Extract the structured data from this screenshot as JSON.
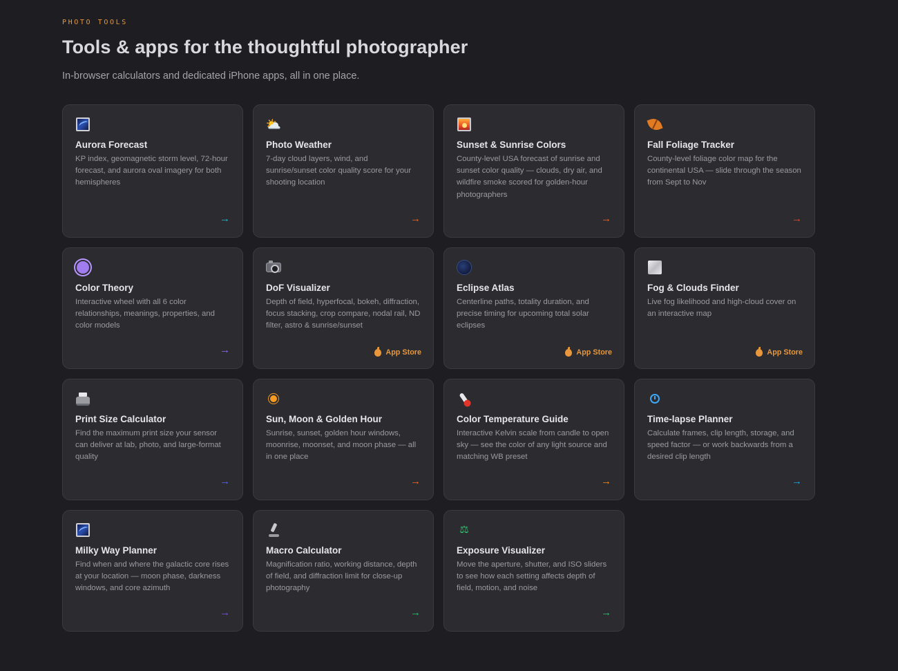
{
  "header": {
    "eyebrow": "PHOTO TOOLS",
    "title": "Tools & apps for the thoughtful photographer",
    "subtitle": "In-browser calculators and dedicated iPhone apps, all in one place."
  },
  "cards": [
    {
      "title": "Aurora Forecast",
      "desc": "KP index, geomagnetic storm level, 72-hour forecast, and aurora oval imagery for both hemispheres",
      "icon": "aurora-icon",
      "action": "arrow",
      "accent": "#27b9d4"
    },
    {
      "title": "Photo Weather",
      "desc": "7-day cloud layers, wind, and sunrise/sunset color quality score for your shooting location",
      "icon": "sun-cloud-icon",
      "action": "arrow",
      "accent": "#f2662a"
    },
    {
      "title": "Sunset & Sunrise Colors",
      "desc": "County-level USA forecast of sunrise and sunset color quality — clouds, dry air, and wildfire smoke scored for golden-hour photographers",
      "icon": "sunset-icon",
      "action": "arrow",
      "accent": "#f2662a"
    },
    {
      "title": "Fall Foliage Tracker",
      "desc": "County-level foliage color map for the continental USA — slide through the season from Sept to Nov",
      "icon": "leaf-icon",
      "action": "arrow",
      "accent": "#e0502a"
    },
    {
      "title": "Color Theory",
      "desc": "Interactive wheel with all 6 color relationships, meanings, properties, and color models",
      "icon": "color-wheel-icon",
      "action": "arrow",
      "accent": "#8f6bf2"
    },
    {
      "title": "DoF Visualizer",
      "desc": "Depth of field, hyperfocal, bokeh, diffraction, focus stacking, crop compare, nodal rail, ND filter, astro & sunrise/sunset",
      "icon": "camera-icon",
      "action": "appstore",
      "accent": "#e8973a"
    },
    {
      "title": "Eclipse Atlas",
      "desc": "Centerline paths, totality duration, and precise timing for upcoming total solar eclipses",
      "icon": "eclipse-icon",
      "action": "appstore",
      "accent": "#e8973a"
    },
    {
      "title": "Fog & Clouds Finder",
      "desc": "Live fog likelihood and high-cloud cover on an interactive map",
      "icon": "fog-icon",
      "action": "appstore",
      "accent": "#e8973a"
    },
    {
      "title": "Print Size Calculator",
      "desc": "Find the maximum print size your sensor can deliver at lab, photo, and large-format quality",
      "icon": "printer-icon",
      "action": "arrow",
      "accent": "#5b63f0"
    },
    {
      "title": "Sun, Moon & Golden Hour",
      "desc": "Sunrise, sunset, golden hour windows, moonrise, moonset, and moon phase — all in one place",
      "icon": "sun-icon",
      "action": "arrow",
      "accent": "#f2662a"
    },
    {
      "title": "Color Temperature Guide",
      "desc": "Interactive Kelvin scale from candle to open sky — see the color of any light source and matching WB preset",
      "icon": "thermometer-icon",
      "action": "arrow",
      "accent": "#f58a1f"
    },
    {
      "title": "Time-lapse Planner",
      "desc": "Calculate frames, clip length, storage, and speed factor — or work backwards from a desired clip length",
      "icon": "timer-icon",
      "action": "arrow",
      "accent": "#1aa3e8"
    },
    {
      "title": "Milky Way Planner",
      "desc": "Find when and where the galactic core rises at your location — moon phase, darkness windows, and core azimuth",
      "icon": "milky-way-icon",
      "action": "arrow",
      "accent": "#7a52e8"
    },
    {
      "title": "Macro Calculator",
      "desc": "Magnification ratio, working distance, depth of field, and diffraction limit for close-up photography",
      "icon": "microscope-icon",
      "action": "arrow",
      "accent": "#2fc46a"
    },
    {
      "title": "Exposure Visualizer",
      "desc": "Move the aperture, shutter, and ISO sliders to see how each setting affects depth of field, motion, and noise",
      "icon": "scale-icon",
      "action": "arrow",
      "accent": "#2fc46a"
    }
  ],
  "arrow_glyph": "→",
  "app_store_label": "App Store",
  "scale_glyph": "⚖",
  "sun_cloud_glyph": "⛅"
}
